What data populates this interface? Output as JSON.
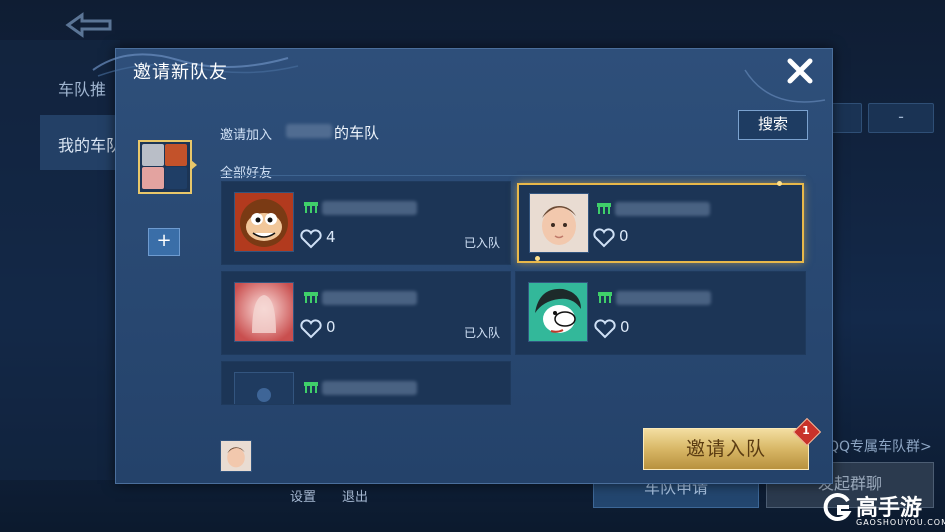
{
  "background": {
    "side_tab_1": "车队推",
    "side_tab_2": "我的车队",
    "right_link": "QQ专属车队群>",
    "btn_team_apply": "车队申请",
    "btn_start_group": "发起群聊",
    "bottom_settings": "设置",
    "bottom_exit": "退出"
  },
  "dialog": {
    "title": "邀请新队友",
    "invite_join_prefix": "邀请加入",
    "team_suffix": "的车队",
    "search_label": "搜索",
    "section_label": "全部好友",
    "add_label": "+",
    "invite_button_label": "邀请入队",
    "badge_count": "1"
  },
  "friends": [
    {
      "hearts": "4",
      "status": "已入队",
      "avatar": "monkey",
      "selected": false
    },
    {
      "hearts": "0",
      "status": "",
      "avatar": "baby",
      "selected": true
    },
    {
      "hearts": "0",
      "status": "已入队",
      "avatar": "ghost",
      "selected": false
    },
    {
      "hearts": "0",
      "status": "",
      "avatar": "cartoon",
      "selected": false
    },
    {
      "hearts": "",
      "status": "",
      "avatar": "default",
      "selected": false
    }
  ],
  "brand": {
    "logo_text": "高手游",
    "logo_sub": "GAOSHOUYOU.COM"
  },
  "colors": {
    "accent_gold": "#e8b84a",
    "rank_green": "#3fcf6a"
  }
}
